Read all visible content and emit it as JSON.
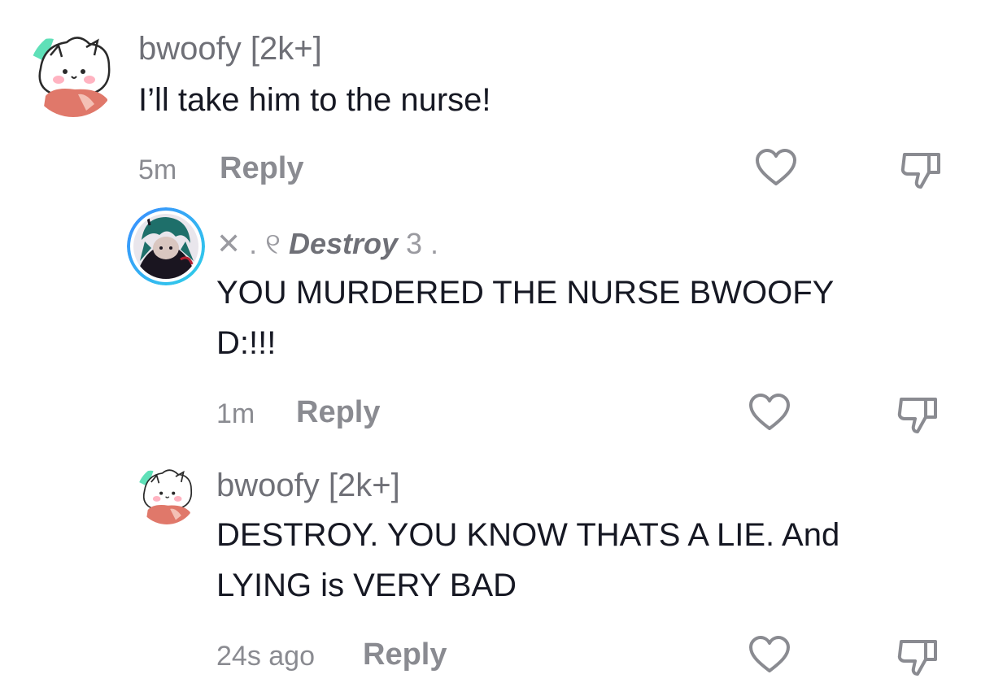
{
  "comments": [
    {
      "username": "bwoofy [2k+]",
      "text_lines": [
        "I’ll take him to the nurse!"
      ],
      "time": "5m",
      "reply_label": "Reply",
      "avatar_icon": "cartoon-animal-avatar-icon",
      "like_icon": "heart-outline-icon",
      "dislike_icon": "thumbs-down-outline-icon"
    },
    {
      "username_deco_left": "✕ . ୧",
      "username_name": "Destroy",
      "username_deco_right": "3 .",
      "text_lines": [
        "YOU MURDERED THE NURSE BWOOFY",
        "D:!!!"
      ],
      "time": "1m",
      "reply_label": "Reply",
      "avatar_icon": "dark-character-avatar-icon",
      "avatar_ring_colors": [
        "#2fd0e8",
        "#3a8dff"
      ],
      "like_icon": "heart-outline-icon",
      "dislike_icon": "thumbs-down-outline-icon"
    },
    {
      "username": "bwoofy [2k+]",
      "text_lines": [
        "DESTROY. YOU KNOW THATS A LIE. And",
        "LYING is VERY BAD"
      ],
      "time": "24s ago",
      "reply_label": "Reply",
      "avatar_icon": "cartoon-animal-avatar-icon",
      "like_icon": "heart-outline-icon",
      "dislike_icon": "thumbs-down-outline-icon"
    }
  ]
}
